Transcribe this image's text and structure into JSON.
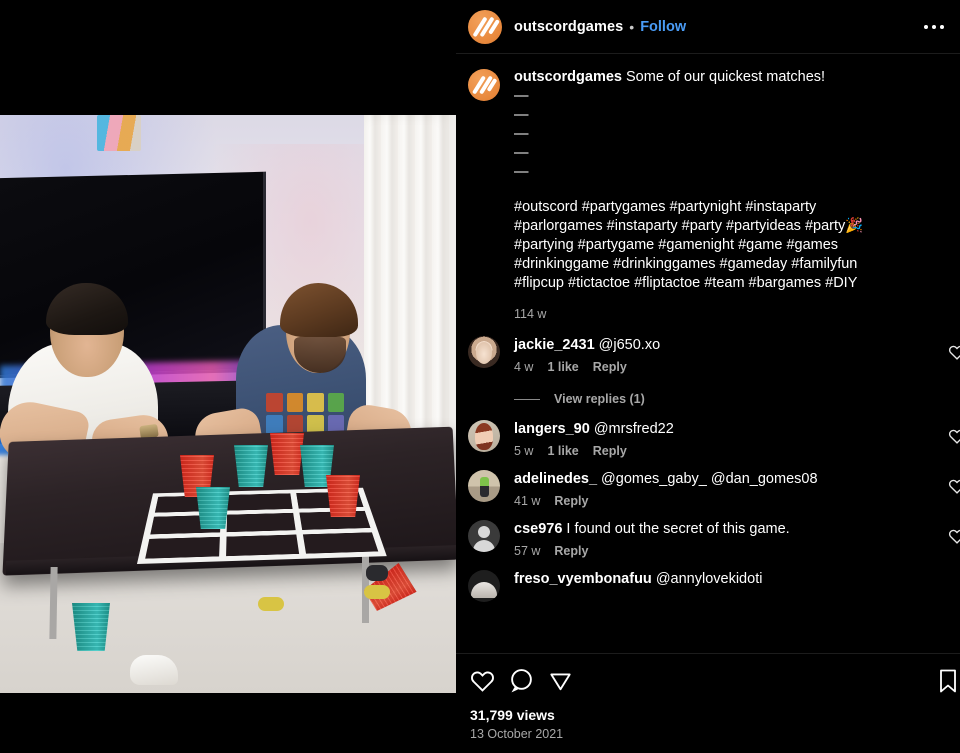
{
  "header": {
    "avatar_icon": "outscord-logo-icon",
    "username": "outscordgames",
    "separator": "•",
    "follow_label": "Follow",
    "more_icon": "more-options-icon"
  },
  "post": {
    "caption": {
      "username": "outscordgames",
      "text": "Some of our quickest matches!",
      "dash_lines": [
        "—",
        "—",
        "—",
        "—",
        "—"
      ],
      "hashtag_lines": [
        "#outscord #partygames #partynight #instaparty",
        "#parlorgames #instaparty #party #partyideas #party🎉",
        "#partying #partygame #gamenight #game #games",
        "#drinkinggame #drinkinggames #gameday #familyfun",
        "#flipcup #tictactoe #fliptactoe #team #bargames #DIY"
      ],
      "timestamp": "114 w"
    },
    "comments": [
      {
        "avatar_icon": "commenter-avatar-jackie",
        "username": "jackie_2431",
        "text": "@j650.xo",
        "time": "4 w",
        "likes": "1 like",
        "reply_label": "Reply",
        "like_icon": "heart-icon",
        "view_replies_label": "View replies (1)"
      },
      {
        "avatar_icon": "commenter-avatar-langers",
        "username": "langers_90",
        "text": "@mrsfred22",
        "time": "5 w",
        "likes": "1 like",
        "reply_label": "Reply",
        "like_icon": "heart-icon"
      },
      {
        "avatar_icon": "commenter-avatar-adelinedes",
        "username": "adelinedes_",
        "text": "@gomes_gaby_ @dan_gomes08",
        "time": "41 w",
        "likes": "",
        "reply_label": "Reply",
        "like_icon": "heart-icon"
      },
      {
        "avatar_icon": "commenter-avatar-cse976",
        "username": "cse976",
        "text": "I found out the secret of this game.",
        "time": "57 w",
        "likes": "",
        "reply_label": "Reply",
        "like_icon": "heart-icon"
      },
      {
        "avatar_icon": "commenter-avatar-freso",
        "username": "freso_vyembonafuu",
        "text": "@annylovekidoti",
        "time": "",
        "likes": "",
        "reply_label": "",
        "like_icon": "heart-icon"
      }
    ],
    "actions": {
      "like_icon": "heart-icon",
      "comment_icon": "comment-bubble-icon",
      "share_icon": "share-paper-plane-icon",
      "save_icon": "bookmark-icon"
    },
    "views": "31,799 views",
    "date": "13 October 2021"
  },
  "media": {
    "type": "video-frame",
    "description": "Two men playing a giant flip-cup tic-tac-toe game on a dark table",
    "board": {
      "rows": [
        [
          "red",
          "teal",
          "red"
        ],
        [
          "teal",
          "empty",
          "red"
        ],
        [
          "empty",
          "empty",
          "teal"
        ]
      ]
    },
    "loose_cups": [
      "teal",
      "red"
    ]
  },
  "colors": {
    "background": "#000000",
    "link_blue": "#4a9cf6",
    "muted_text": "#a8a8a8",
    "brand_orange": "#e8883c",
    "cup_red": "#e8402e",
    "cup_teal": "#2fb3ac"
  }
}
